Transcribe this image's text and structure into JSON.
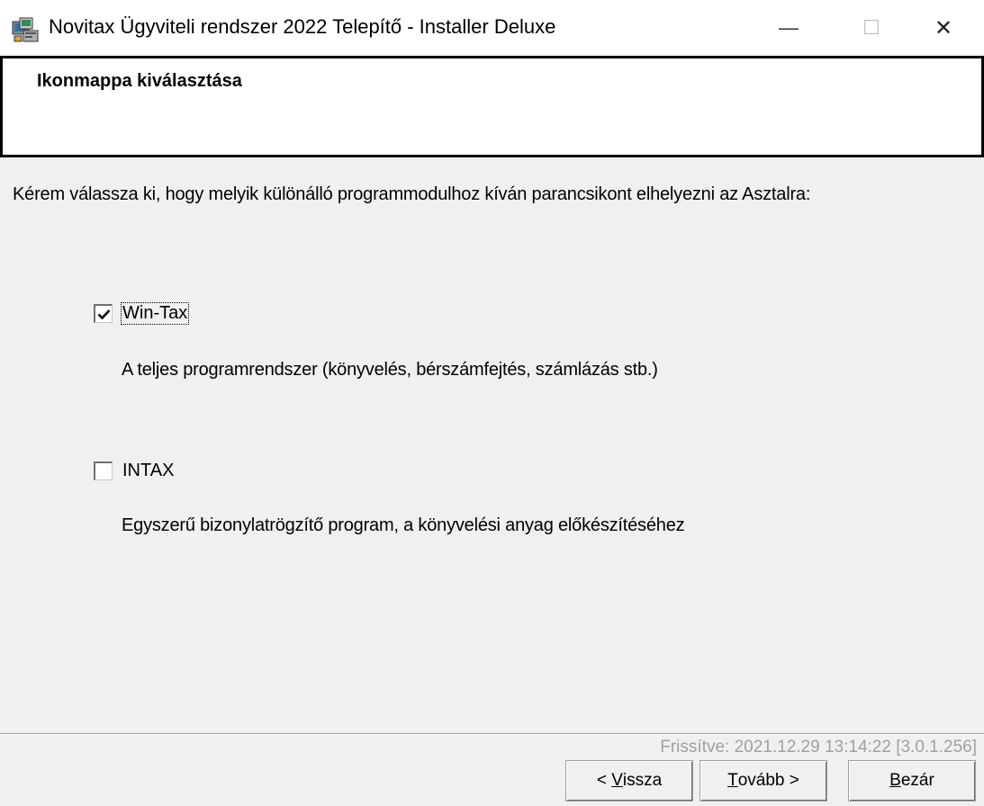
{
  "window": {
    "title": "Novitax Ügyviteli rendszer 2022 Telepítő - Installer Deluxe",
    "minimize_glyph": "—",
    "maximize_glyph": "☐",
    "close_glyph": "✕"
  },
  "header": {
    "title": "Ikonmappa kiválasztása"
  },
  "main": {
    "instruction": "Kérem válassza ki, hogy melyik különálló programmodulhoz kíván parancsikont elhelyezni az Asztalra:",
    "options": [
      {
        "label": "Win-Tax",
        "checked": true,
        "description": "A teljes programrendszer (könyvelés, bérszámfejtés, számlázás stb.)"
      },
      {
        "label": "INTAX",
        "checked": false,
        "description": "Egyszerű bizonylatrögzítő program, a könyvelési anyag előkészítéséhez"
      }
    ]
  },
  "footer": {
    "updated": "Frissítve: 2021.12.29  13:14:22  [3.0.1.256]",
    "back_prefix": "< ",
    "back_mnemonic": "V",
    "back_rest": "issza",
    "next_mnemonic": "T",
    "next_rest": "ovább >",
    "close_mnemonic": "B",
    "close_rest": "ezár"
  },
  "colors": {
    "content_bg": "#f0f0f0",
    "disabled_text": "#a0a0a0",
    "header_bg": "#ffffff"
  }
}
